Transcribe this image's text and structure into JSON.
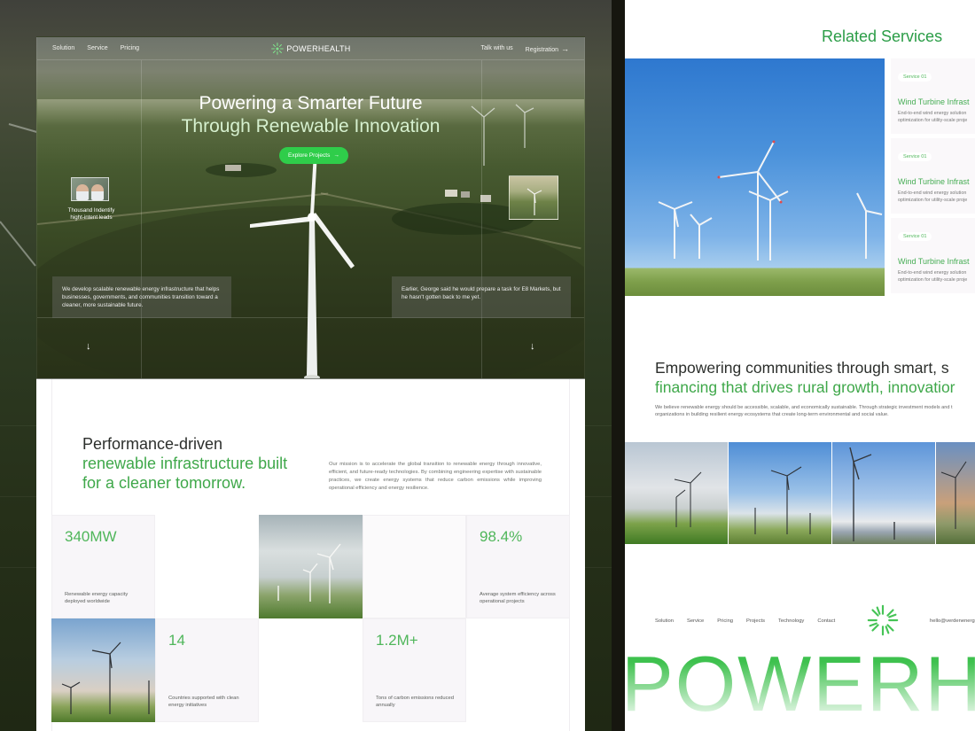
{
  "hero": {
    "nav_left": [
      "Solution",
      "Service",
      "Pricing"
    ],
    "brand": "POWERHEALTH",
    "nav_right": {
      "talk": "Talk with us",
      "registration": "Registration"
    },
    "title_line1": "Powering a Smarter Future",
    "title_line2": "Through Renewable Innovation",
    "cta": "Explore Projects",
    "avatar_caption": "Thousand Indentify hight-intent leads",
    "info_left": "We develop scalable renewable energy infrastructure that helps businesses, governments, and communities transition toward a cleaner, more sustainable future.",
    "info_right": "Earlier, George said he would prepare a task for E8 Markets, but he hasn't gotten back to me yet.",
    "arrow": "↓"
  },
  "performance": {
    "title_line1": "Performance-driven",
    "title_line2": "renewable infrastructure built",
    "title_line3": "for a cleaner tomorrow.",
    "mission": "Our mission is to accelerate the global transition to renewable energy through innovative, efficient, and future-ready technologies. By combining engineering expertise with sustainable practices, we create energy systems that reduce carbon emissions while improving operational efficiency and energy resilience.",
    "stats": [
      {
        "value": "340MW",
        "caption": "Renewable energy capacity deployed worldwide"
      },
      {
        "value": "98.4%",
        "caption": "Average system efficiency across operational projects"
      },
      {
        "value": "14",
        "caption": "Countries supported with clean energy initiatives"
      },
      {
        "value": "1.2M+",
        "caption": "Tons of carbon emissions reduced annually"
      }
    ]
  },
  "related": {
    "title": "Related Services",
    "services": [
      {
        "tag": "Service 01",
        "name": "Wind Turbine Infrast",
        "desc_line1": "End-to-end wind energy solution",
        "desc_line2": "optimization for utility-scale proje"
      },
      {
        "tag": "Service 01",
        "name": "Wind Turbine Infrast",
        "desc_line1": "End-to-end wind energy solution",
        "desc_line2": "optimization for utility-scale proje"
      },
      {
        "tag": "Service 01",
        "name": "Wind Turbine Infrast",
        "desc_line1": "End-to-end wind energy solution",
        "desc_line2": "optimization for utility-scale proje"
      }
    ]
  },
  "empower": {
    "line1": "Empowering communities through smart, s",
    "line2": "financing that drives rural growth, innovatior",
    "para_line1": "We believe renewable energy should be accessible, scalable, and economically sustainable. Through strategic investment models and t",
    "para_line2": "organizations in building resilient energy ecosystems that create long-term environmental and social value."
  },
  "footer": {
    "nav": [
      "Solution",
      "Service",
      "Pricing",
      "Projects",
      "Technology",
      "Contact"
    ],
    "email": "hello@verdenenerg",
    "wordmark": "POWERHE"
  },
  "colors": {
    "accent": "#2fcd4a",
    "accent_text": "#3fa84a",
    "cell_bg": "#f8f6f9"
  }
}
